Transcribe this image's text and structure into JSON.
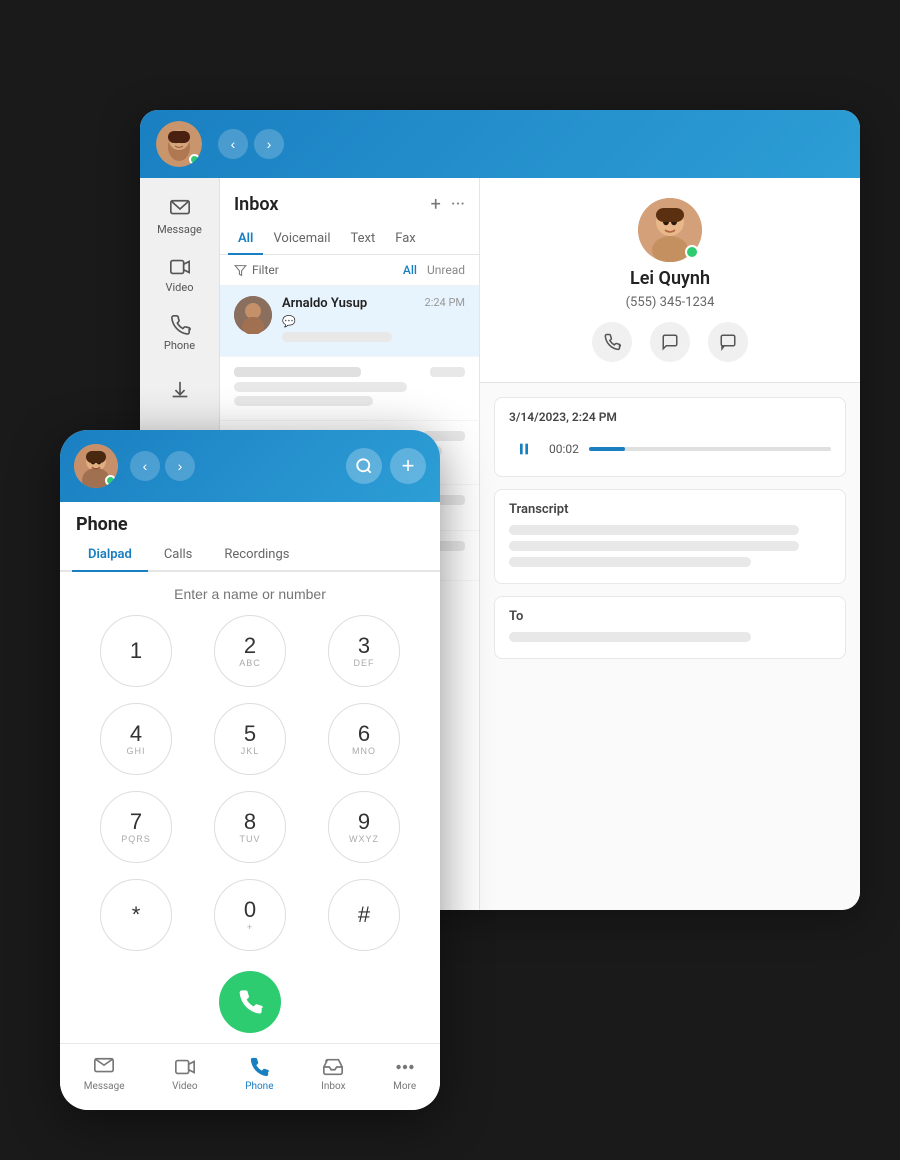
{
  "tablet": {
    "header": {
      "nav_back": "‹",
      "nav_fwd": "›"
    },
    "sidebar": {
      "items": [
        {
          "icon": "message-icon",
          "label": "Message"
        },
        {
          "icon": "video-icon",
          "label": "Video"
        },
        {
          "icon": "phone-icon",
          "label": "Phone"
        },
        {
          "icon": "more-icon",
          "label": ""
        }
      ]
    },
    "inbox": {
      "title": "Inbox",
      "tabs": [
        "All",
        "Voicemail",
        "Text",
        "Fax"
      ],
      "active_tab": "All",
      "filter_label": "Filter",
      "filter_all": "All",
      "filter_unread": "Unread",
      "items": [
        {
          "name": "Arnaldo Yusup",
          "time": "2:24 PM",
          "avatar_color": "#8a6e5e"
        }
      ]
    },
    "contact": {
      "name": "Lei Quynh",
      "phone": "(555) 345-1234",
      "recording_date": "3/14/2023, 2:24 PM",
      "audio_time": "00:02",
      "transcript_label": "Transcript",
      "to_label": "To"
    }
  },
  "phone": {
    "title": "Phone",
    "tabs": [
      "Dialpad",
      "Calls",
      "Recordings"
    ],
    "active_tab": "Dialpad",
    "input_placeholder": "Enter a name or number",
    "keys": [
      {
        "num": "1",
        "sub": ""
      },
      {
        "num": "2",
        "sub": "ABC"
      },
      {
        "num": "3",
        "sub": "DEF"
      },
      {
        "num": "4",
        "sub": "GHI"
      },
      {
        "num": "5",
        "sub": "JKL"
      },
      {
        "num": "6",
        "sub": "MNO"
      },
      {
        "num": "7",
        "sub": "PQRS"
      },
      {
        "num": "8",
        "sub": "TUV"
      },
      {
        "num": "9",
        "sub": "WXYZ"
      },
      {
        "num": "*",
        "sub": ""
      },
      {
        "num": "0",
        "sub": "+"
      },
      {
        "num": "#",
        "sub": ""
      }
    ],
    "footer": [
      {
        "icon": "message-icon",
        "label": "Message"
      },
      {
        "icon": "video-icon",
        "label": "Video"
      },
      {
        "icon": "phone-icon",
        "label": "Phone"
      },
      {
        "icon": "inbox-icon",
        "label": "Inbox"
      },
      {
        "icon": "more-icon",
        "label": "More"
      }
    ]
  }
}
